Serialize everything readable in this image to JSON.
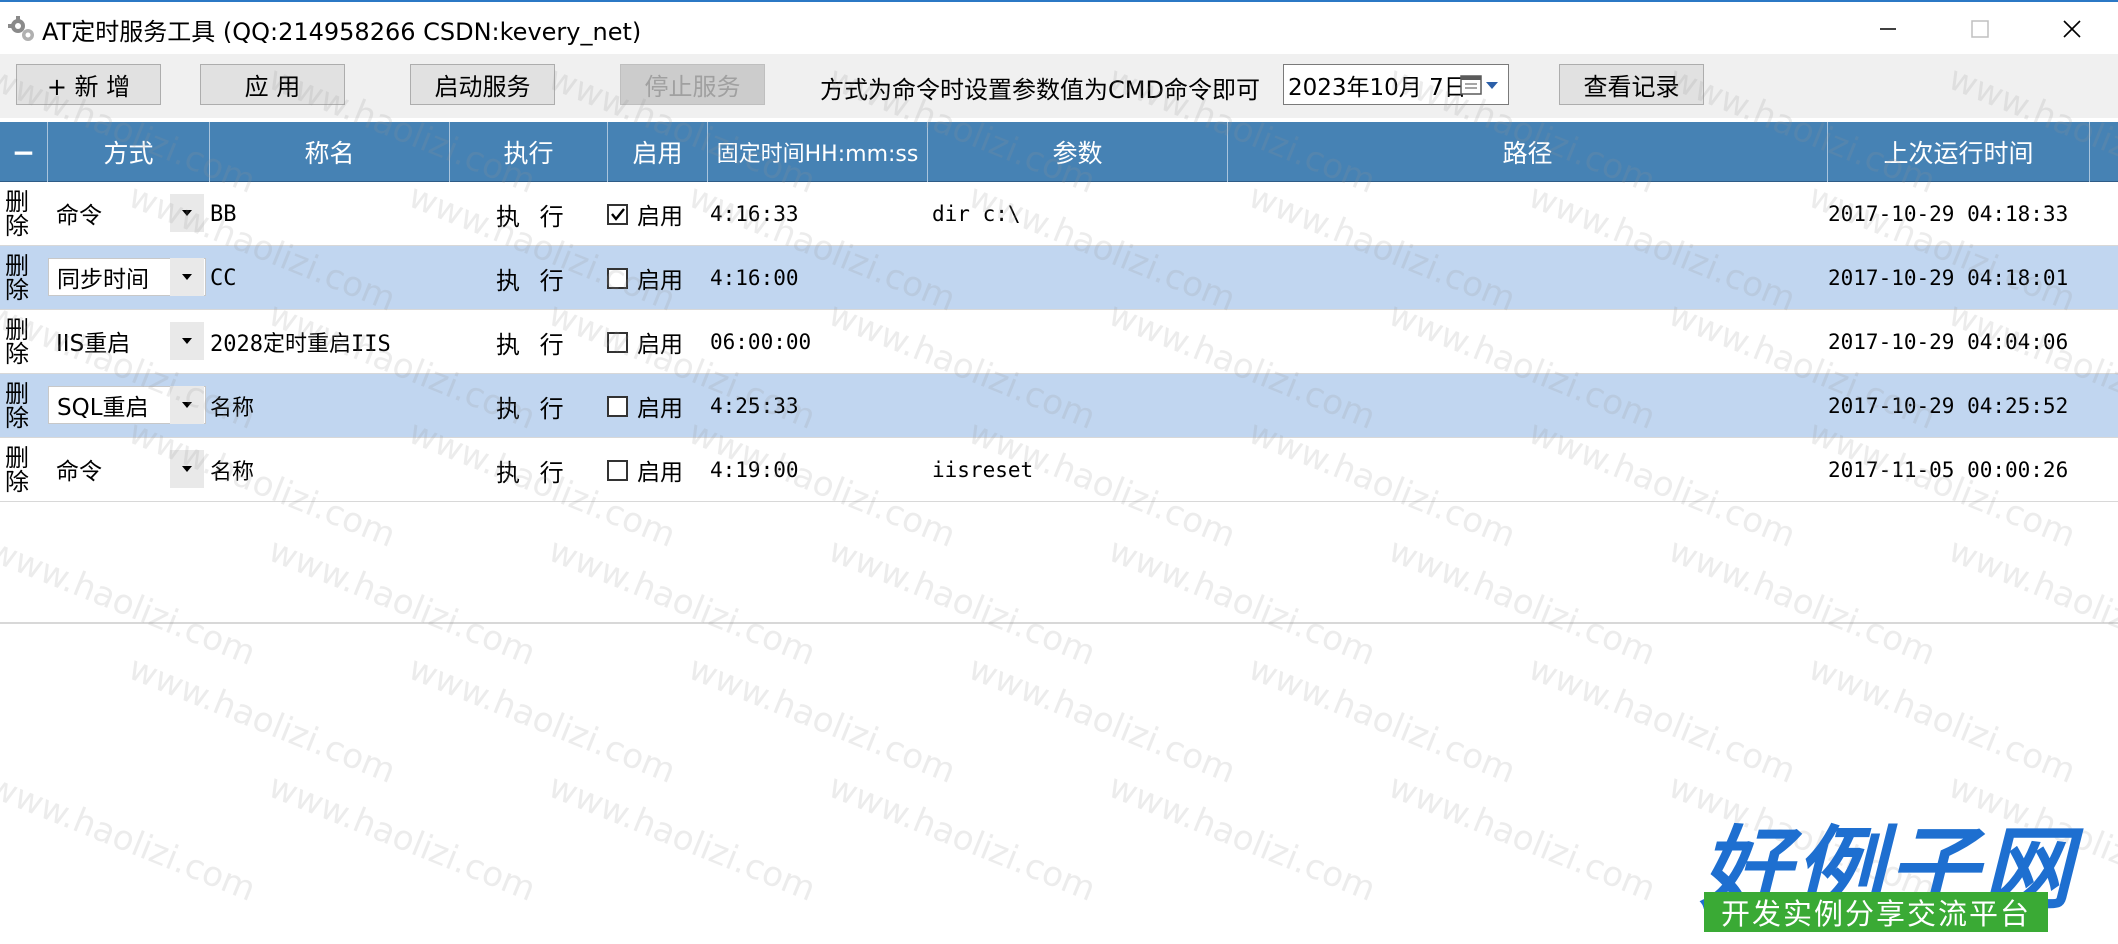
{
  "window": {
    "title": "AT定时服务工具 (QQ:214958266 CSDN:kevery_net)"
  },
  "toolbar": {
    "add_label": "+ 新 增",
    "apply_label": "应 用",
    "start_label": "启动服务",
    "stop_label": "停止服务",
    "hint": "方式为命令时设置参数值为CMD命令即可",
    "date_value": "2023年10月  7日",
    "view_log_label": "查看记录"
  },
  "grid": {
    "columns": [
      "−",
      "方式",
      "称名",
      "执行",
      "启用",
      "固定时间HH:mm:ss",
      "参数",
      "路径",
      "上次运行时间"
    ],
    "delete_label_1": "删",
    "delete_label_2": "除",
    "exec_label": "执 行",
    "enable_label": "启用",
    "rows": [
      {
        "mode": "命令",
        "name": "BB",
        "enabled": true,
        "time": "4:16:33",
        "param": "dir c:\\",
        "path": "",
        "last_run": "2017-10-29 04:18:33"
      },
      {
        "mode": "同步时间",
        "name": "CC",
        "enabled": false,
        "time": "4:16:00",
        "param": "",
        "path": "",
        "last_run": "2017-10-29 04:18:01"
      },
      {
        "mode": "IIS重启",
        "name": "2028定时重启IIS",
        "enabled": false,
        "time": "06:00:00",
        "param": "",
        "path": "",
        "last_run": "2017-10-29 04:04:06"
      },
      {
        "mode": "SQL重启",
        "name": "名称",
        "enabled": false,
        "time": "4:25:33",
        "param": "",
        "path": "",
        "last_run": "2017-10-29 04:25:52"
      },
      {
        "mode": "命令",
        "name": "名称",
        "enabled": false,
        "time": "4:19:00",
        "param": "iisreset",
        "path": "",
        "last_run": "2017-11-05 00:00:26"
      }
    ]
  },
  "watermark": {
    "text": "www.haolizi.com",
    "logo_title": "好例子网",
    "logo_subtitle": "开发实例分享交流平台"
  },
  "colors": {
    "header_bg": "#4682b4",
    "alt_row_bg": "#c1d6f0",
    "logo_blue": "#1e6fd0",
    "logo_green": "#3aaa35"
  }
}
